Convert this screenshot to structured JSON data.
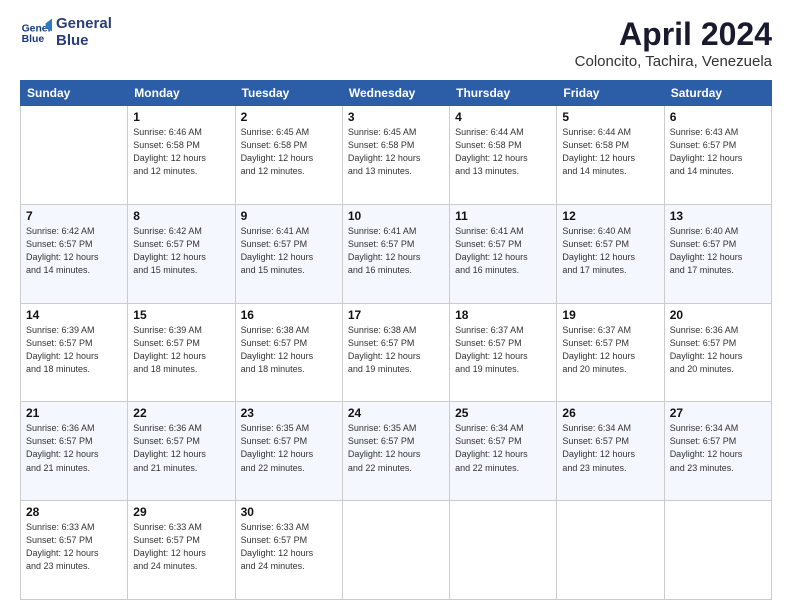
{
  "logo": {
    "line1": "General",
    "line2": "Blue"
  },
  "title": "April 2024",
  "subtitle": "Coloncito, Tachira, Venezuela",
  "days_header": [
    "Sunday",
    "Monday",
    "Tuesday",
    "Wednesday",
    "Thursday",
    "Friday",
    "Saturday"
  ],
  "weeks": [
    [
      {
        "day": "",
        "info": ""
      },
      {
        "day": "1",
        "info": "Sunrise: 6:46 AM\nSunset: 6:58 PM\nDaylight: 12 hours\nand 12 minutes."
      },
      {
        "day": "2",
        "info": "Sunrise: 6:45 AM\nSunset: 6:58 PM\nDaylight: 12 hours\nand 12 minutes."
      },
      {
        "day": "3",
        "info": "Sunrise: 6:45 AM\nSunset: 6:58 PM\nDaylight: 12 hours\nand 13 minutes."
      },
      {
        "day": "4",
        "info": "Sunrise: 6:44 AM\nSunset: 6:58 PM\nDaylight: 12 hours\nand 13 minutes."
      },
      {
        "day": "5",
        "info": "Sunrise: 6:44 AM\nSunset: 6:58 PM\nDaylight: 12 hours\nand 14 minutes."
      },
      {
        "day": "6",
        "info": "Sunrise: 6:43 AM\nSunset: 6:57 PM\nDaylight: 12 hours\nand 14 minutes."
      }
    ],
    [
      {
        "day": "7",
        "info": "Sunrise: 6:42 AM\nSunset: 6:57 PM\nDaylight: 12 hours\nand 14 minutes."
      },
      {
        "day": "8",
        "info": "Sunrise: 6:42 AM\nSunset: 6:57 PM\nDaylight: 12 hours\nand 15 minutes."
      },
      {
        "day": "9",
        "info": "Sunrise: 6:41 AM\nSunset: 6:57 PM\nDaylight: 12 hours\nand 15 minutes."
      },
      {
        "day": "10",
        "info": "Sunrise: 6:41 AM\nSunset: 6:57 PM\nDaylight: 12 hours\nand 16 minutes."
      },
      {
        "day": "11",
        "info": "Sunrise: 6:41 AM\nSunset: 6:57 PM\nDaylight: 12 hours\nand 16 minutes."
      },
      {
        "day": "12",
        "info": "Sunrise: 6:40 AM\nSunset: 6:57 PM\nDaylight: 12 hours\nand 17 minutes."
      },
      {
        "day": "13",
        "info": "Sunrise: 6:40 AM\nSunset: 6:57 PM\nDaylight: 12 hours\nand 17 minutes."
      }
    ],
    [
      {
        "day": "14",
        "info": "Sunrise: 6:39 AM\nSunset: 6:57 PM\nDaylight: 12 hours\nand 18 minutes."
      },
      {
        "day": "15",
        "info": "Sunrise: 6:39 AM\nSunset: 6:57 PM\nDaylight: 12 hours\nand 18 minutes."
      },
      {
        "day": "16",
        "info": "Sunrise: 6:38 AM\nSunset: 6:57 PM\nDaylight: 12 hours\nand 18 minutes."
      },
      {
        "day": "17",
        "info": "Sunrise: 6:38 AM\nSunset: 6:57 PM\nDaylight: 12 hours\nand 19 minutes."
      },
      {
        "day": "18",
        "info": "Sunrise: 6:37 AM\nSunset: 6:57 PM\nDaylight: 12 hours\nand 19 minutes."
      },
      {
        "day": "19",
        "info": "Sunrise: 6:37 AM\nSunset: 6:57 PM\nDaylight: 12 hours\nand 20 minutes."
      },
      {
        "day": "20",
        "info": "Sunrise: 6:36 AM\nSunset: 6:57 PM\nDaylight: 12 hours\nand 20 minutes."
      }
    ],
    [
      {
        "day": "21",
        "info": "Sunrise: 6:36 AM\nSunset: 6:57 PM\nDaylight: 12 hours\nand 21 minutes."
      },
      {
        "day": "22",
        "info": "Sunrise: 6:36 AM\nSunset: 6:57 PM\nDaylight: 12 hours\nand 21 minutes."
      },
      {
        "day": "23",
        "info": "Sunrise: 6:35 AM\nSunset: 6:57 PM\nDaylight: 12 hours\nand 22 minutes."
      },
      {
        "day": "24",
        "info": "Sunrise: 6:35 AM\nSunset: 6:57 PM\nDaylight: 12 hours\nand 22 minutes."
      },
      {
        "day": "25",
        "info": "Sunrise: 6:34 AM\nSunset: 6:57 PM\nDaylight: 12 hours\nand 22 minutes."
      },
      {
        "day": "26",
        "info": "Sunrise: 6:34 AM\nSunset: 6:57 PM\nDaylight: 12 hours\nand 23 minutes."
      },
      {
        "day": "27",
        "info": "Sunrise: 6:34 AM\nSunset: 6:57 PM\nDaylight: 12 hours\nand 23 minutes."
      }
    ],
    [
      {
        "day": "28",
        "info": "Sunrise: 6:33 AM\nSunset: 6:57 PM\nDaylight: 12 hours\nand 23 minutes."
      },
      {
        "day": "29",
        "info": "Sunrise: 6:33 AM\nSunset: 6:57 PM\nDaylight: 12 hours\nand 24 minutes."
      },
      {
        "day": "30",
        "info": "Sunrise: 6:33 AM\nSunset: 6:57 PM\nDaylight: 12 hours\nand 24 minutes."
      },
      {
        "day": "",
        "info": ""
      },
      {
        "day": "",
        "info": ""
      },
      {
        "day": "",
        "info": ""
      },
      {
        "day": "",
        "info": ""
      }
    ]
  ]
}
